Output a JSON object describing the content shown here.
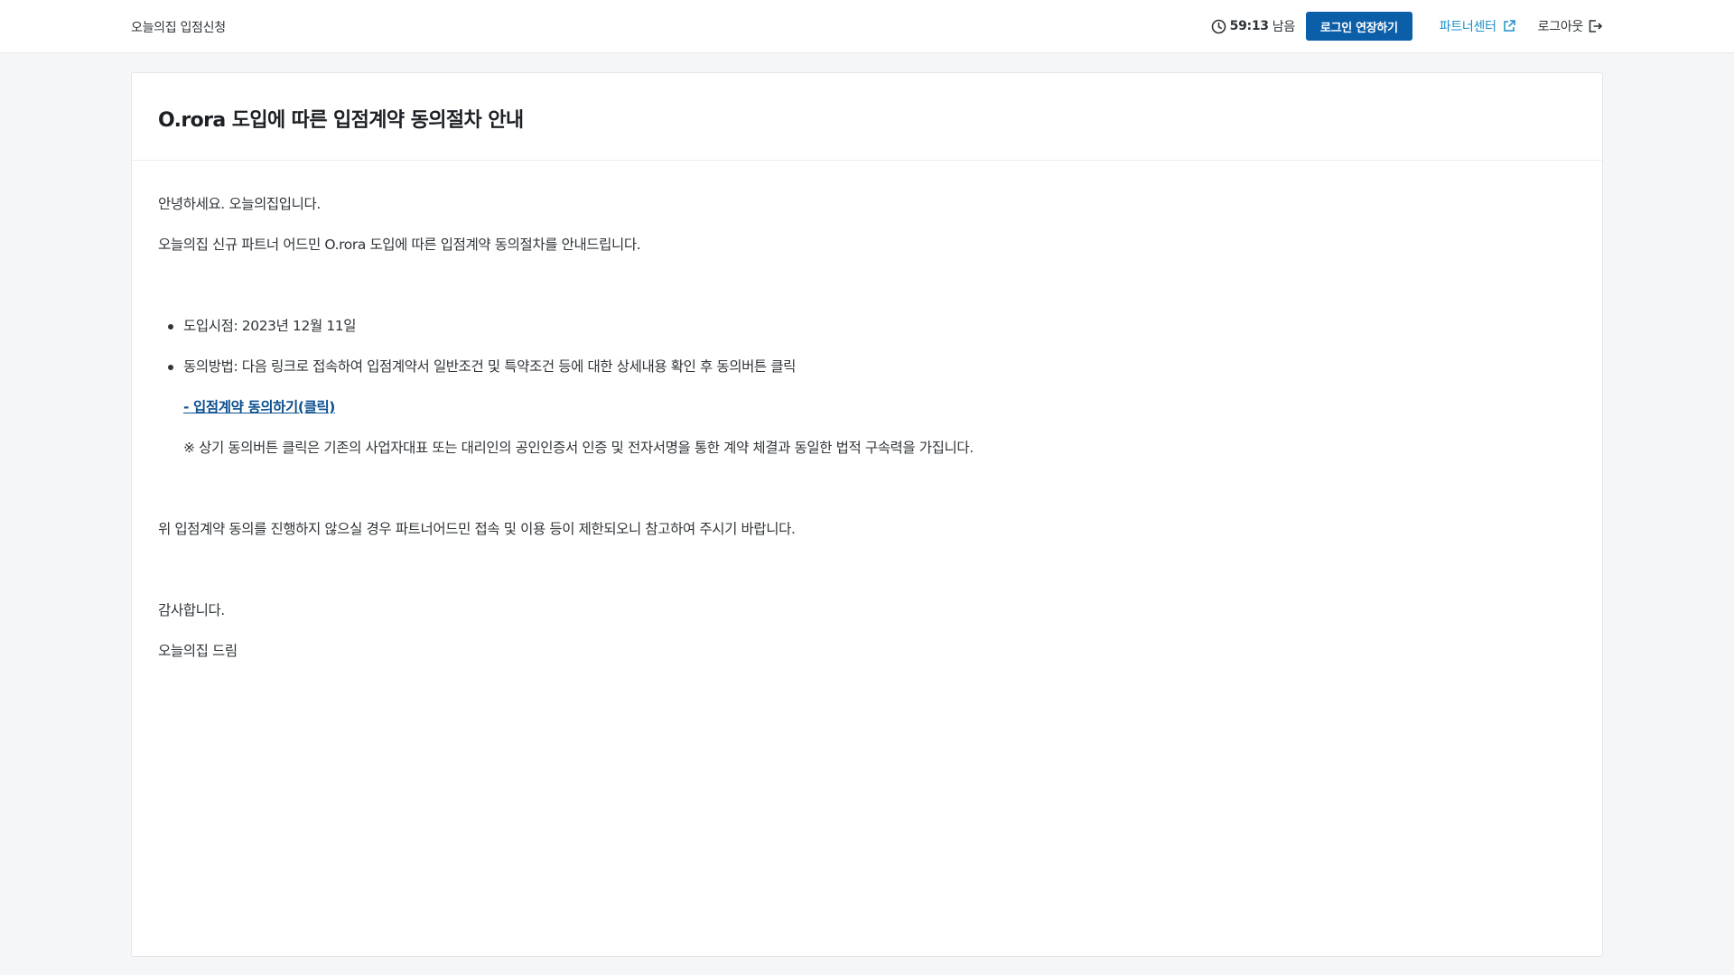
{
  "header": {
    "brand": "오늘의집 입점신청",
    "timer_value": "59:13",
    "timer_suffix": "남음",
    "extend_button": "로그인 연장하기",
    "partner_center": "파트너센터",
    "logout": "로그아웃",
    "icons": {
      "timer": "clock-icon",
      "partner": "external-link-icon",
      "logout": "logout-icon"
    },
    "colors": {
      "accent_button": "#0b5ea8",
      "link": "#1a8fc9"
    }
  },
  "notice": {
    "title": "O.rora 도입에 따른 입점계약 동의절차 안내",
    "greeting": "안녕하세요. 오늘의집입니다.",
    "intro": "오늘의집 신규 파트너 어드민 O.rora 도입에 따른 입점계약 동의절차를 안내드립니다.",
    "bullets": [
      "도입시점: 2023년 12월 11일",
      "동의방법: 다음 링크로 접속하여 입점계약서 일반조건 및 특약조건 등에 대한 상세내용 확인 후 동의버튼 클릭"
    ],
    "agree_link": "- 입점계약 동의하기(클릭)",
    "note": "※ 상기 동의버튼 클릭은 기존의 사업자대표 또는 대리인의 공인인증서 인증 및 전자서명을 통한 계약 체결과 동일한 법적 구속력을 가집니다.",
    "warning": "위 입점계약 동의를 진행하지 않으실 경우 파트너어드민 접속 및 이용 등이 제한되오니 참고하여 주시기 바랍니다.",
    "thanks": "감사합니다.",
    "signature": "오늘의집 드림",
    "colors": {
      "agree_link": "#0b4f8f"
    }
  }
}
